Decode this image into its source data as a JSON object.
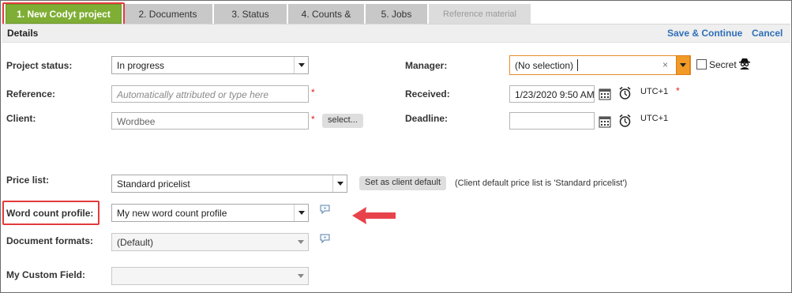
{
  "tabs": [
    {
      "label": "1. New Codyt project"
    },
    {
      "label": "2. Documents"
    },
    {
      "label": "3. Status"
    },
    {
      "label": "4. Counts &"
    },
    {
      "label": "5. Jobs"
    },
    {
      "label": "Reference material"
    }
  ],
  "header": {
    "title": "Details",
    "save_label": "Save & Continue",
    "cancel_label": "Cancel"
  },
  "form": {
    "project_status": {
      "label": "Project status:",
      "value": "In progress"
    },
    "reference": {
      "label": "Reference:",
      "placeholder": "Automatically attributed or type here",
      "required_mark": "*"
    },
    "client": {
      "label": "Client:",
      "value": "Wordbee",
      "required_mark": "*",
      "select_label": "select..."
    },
    "manager": {
      "label": "Manager:",
      "value": "(No selection)",
      "clear_symbol": "×",
      "secret_label": "Secret"
    },
    "received": {
      "label": "Received:",
      "value": "1/23/2020 9:50 AM",
      "tz": "UTC+1",
      "required_mark": "*"
    },
    "deadline": {
      "label": "Deadline:",
      "value": "",
      "tz": "UTC+1"
    },
    "price_list": {
      "label": "Price list:",
      "value": "Standard pricelist",
      "button_label": "Set as client default",
      "note": "(Client default price list is 'Standard pricelist')"
    },
    "word_count_profile": {
      "label": "Word count profile:",
      "value": "My new word count profile"
    },
    "document_formats": {
      "label": "Document formats:",
      "value": "(Default)"
    },
    "custom_field": {
      "label": "My Custom Field:",
      "value": ""
    }
  },
  "colors": {
    "active_tab": "#7fae35",
    "highlight": "#e33b3b",
    "link": "#2f6fb8",
    "manager_accent": "#f29a28",
    "arrow": "#e8434b"
  }
}
